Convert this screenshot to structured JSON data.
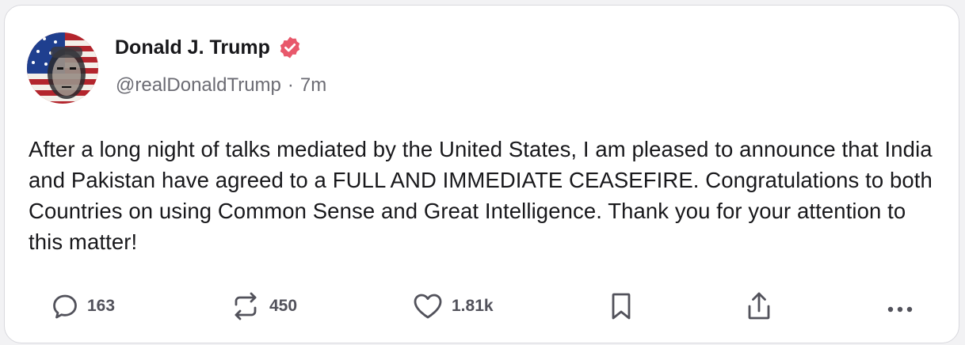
{
  "author": {
    "display_name": "Donald J. Trump",
    "handle": "@realDonaldTrump",
    "separator": "·",
    "time": "7m",
    "verified_color": "#e8586b"
  },
  "post": {
    "text": "After a long night of talks mediated by the United States, I am pleased to announce that India and Pakistan have agreed to a FULL AND IMMEDIATE CEASEFIRE. Congratulations to both Countries on using Common Sense and Great Intelligence. Thank you for your attention to this matter!"
  },
  "actions": {
    "replies": "163",
    "reposts": "450",
    "likes": "1.81k"
  },
  "icons": [
    "reply-icon",
    "repost-icon",
    "like-icon",
    "bookmark-icon",
    "share-icon",
    "more-icon"
  ]
}
